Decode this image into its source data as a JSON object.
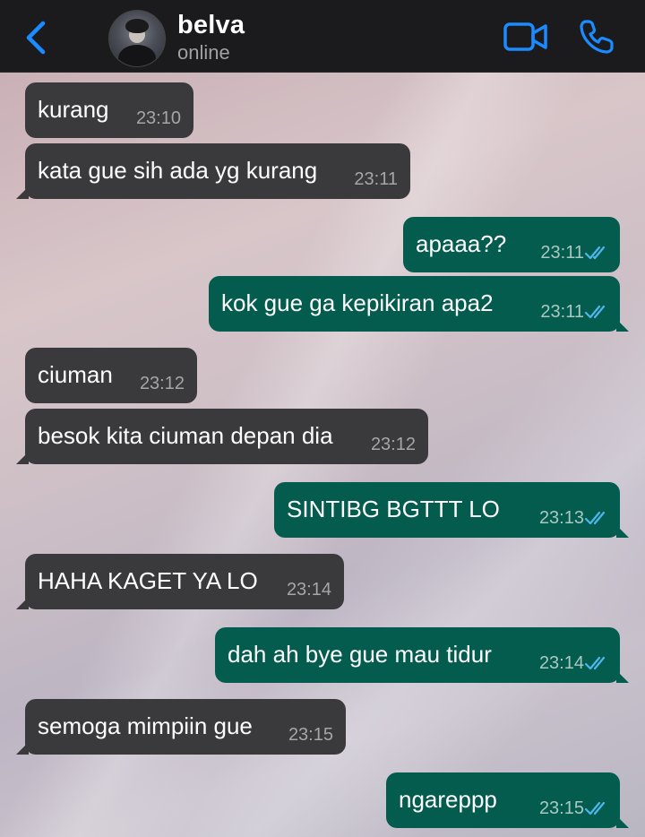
{
  "header": {
    "contact_name": "belva",
    "status": "online"
  },
  "colors": {
    "accent": "#1a8cff",
    "incoming_bubble": "#3a3a3c",
    "outgoing_bubble": "#045c4e",
    "read_ticks": "#4fb6ec"
  },
  "icons": {
    "back": "chevron-left-icon",
    "video": "video-camera-icon",
    "call": "phone-icon",
    "read": "double-check-icon"
  },
  "messages": [
    {
      "direction": "in",
      "text": "kurang",
      "time": "23:10"
    },
    {
      "direction": "in",
      "text": "kata gue sih ada yg kurang",
      "time": "23:11"
    },
    {
      "direction": "out",
      "text": "apaaa??",
      "time": "23:11"
    },
    {
      "direction": "out",
      "text": "kok gue ga kepikiran apa2",
      "time": "23:11"
    },
    {
      "direction": "in",
      "text": "ciuman",
      "time": "23:12"
    },
    {
      "direction": "in",
      "text": "besok kita ciuman depan dia",
      "time": "23:12"
    },
    {
      "direction": "out",
      "text": "SINTIBG BGTTT LO",
      "time": "23:13"
    },
    {
      "direction": "in",
      "text": "HAHA KAGET YA LO",
      "time": "23:14"
    },
    {
      "direction": "out",
      "text": "dah ah bye gue mau tidur",
      "time": "23:14"
    },
    {
      "direction": "in",
      "text": "semoga mimpiin gue",
      "time": "23:15"
    },
    {
      "direction": "out",
      "text": "ngareppp",
      "time": "23:15"
    }
  ]
}
